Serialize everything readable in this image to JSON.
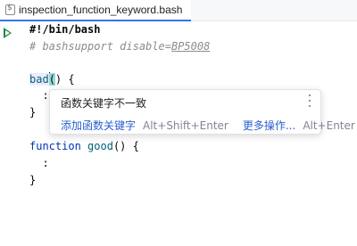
{
  "tab": {
    "filename": "inspection_function_keyword.bash",
    "icon": "shell-file-icon"
  },
  "gutter": {
    "run_icon": "run-icon"
  },
  "code": {
    "line1_shebang": "#!/bin/bash",
    "line2_comment_prefix": "# bashsupport disable=",
    "line2_comment_code": "BP5008",
    "line4_fn_name": "bad",
    "line4_paren_open": "(",
    "line4_rest": ") {",
    "line5_body": "  :",
    "line6_close": "}",
    "line8_keyword": "function",
    "line8_fn_name": "good",
    "line8_rest": "() {",
    "line9_body": "  :",
    "line10_close": "}"
  },
  "popup": {
    "message": "函数关键字不一致",
    "more_icon": "more-vertical-icon",
    "action_label": "添加函数关键字",
    "action_shortcut": "Alt+Shift+Enter",
    "more_actions_label": "更多操作...",
    "more_actions_shortcut": "Alt+Enter"
  },
  "colors": {
    "keyword": "#0033b3",
    "function_name": "#00627a",
    "comment": "#8c8c8c",
    "link": "#2a5fd1",
    "run_icon": "#208a3c",
    "tab_underline": "#3574f0",
    "brace_highlight": "#93d9d9"
  }
}
